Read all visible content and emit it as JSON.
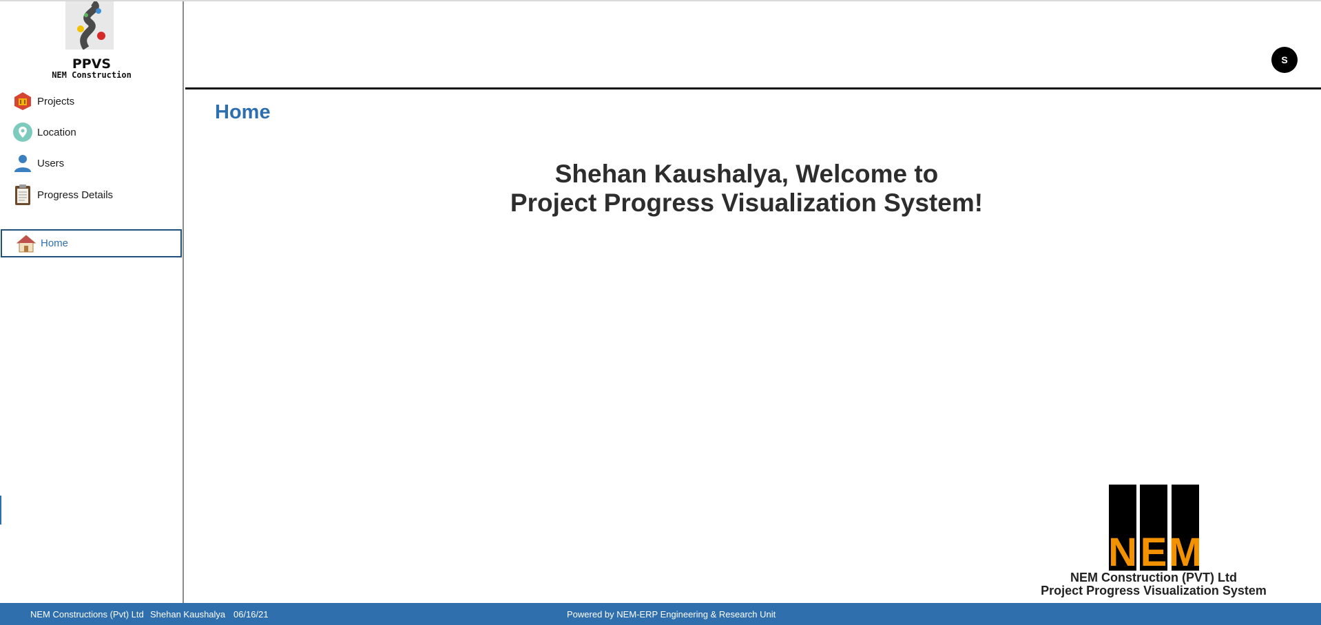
{
  "brand": {
    "title": "PPVS",
    "subtitle": "NEM Construction"
  },
  "sidebar": {
    "items": [
      {
        "label": "Projects",
        "icon": "projects-icon"
      },
      {
        "label": "Location",
        "icon": "location-pin-icon"
      },
      {
        "label": "Users",
        "icon": "user-icon"
      },
      {
        "label": "Progress Details",
        "icon": "clipboard-icon"
      }
    ],
    "active": {
      "label": "Home",
      "icon": "home-icon"
    }
  },
  "header": {
    "avatar_initial": "S"
  },
  "main": {
    "page_title": "Home",
    "welcome_line1": "Shehan Kaushalya, Welcome to",
    "welcome_line2": "Project Progress Visualization System!"
  },
  "logo_block": {
    "logo_text": "NEM",
    "caption1": "NEM Construction (PVT) Ltd",
    "caption2": "Project Progress Visualization System"
  },
  "footer": {
    "company": "NEM Constructions (Pvt) Ltd",
    "user": "Shehan Kaushalya",
    "date": "06/16/21",
    "powered": "Powered by NEM-ERP Engineering & Research Unit"
  },
  "colors": {
    "accent": "#2e6fb0",
    "footer_bg": "#2f6fad",
    "logo_orange": "#f39200"
  }
}
